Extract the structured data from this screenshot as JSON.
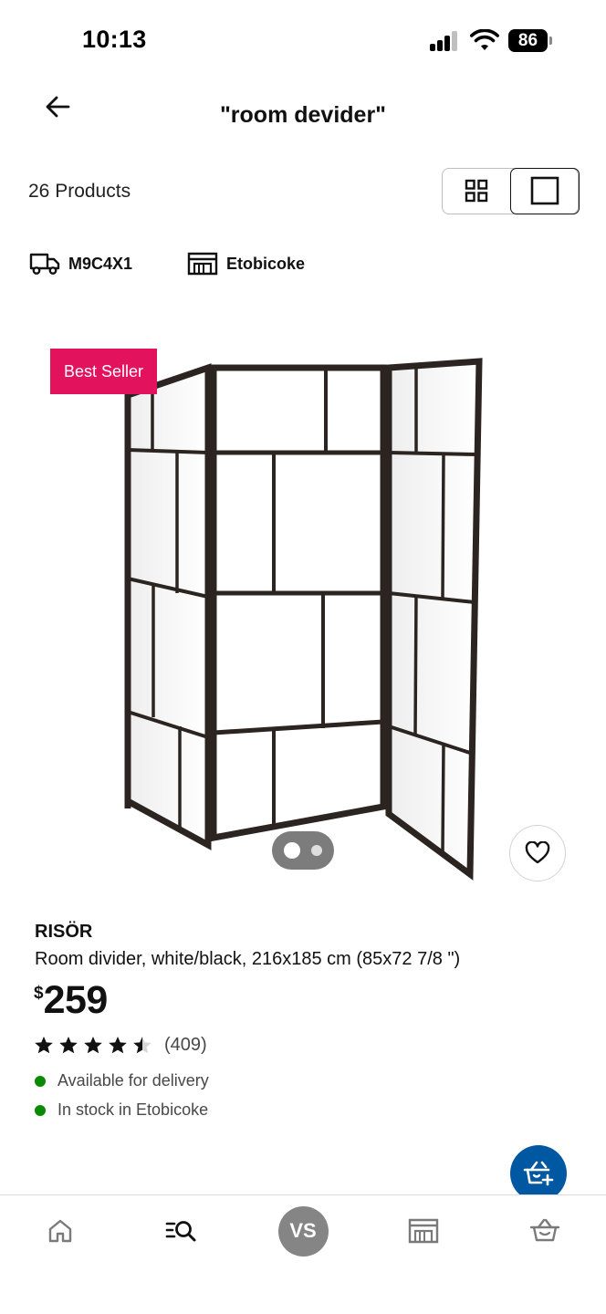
{
  "status_bar": {
    "time": "10:13",
    "battery": "86"
  },
  "header": {
    "title": "\"room devider\""
  },
  "toolbar": {
    "product_count": "26 Products",
    "view_mode": "single"
  },
  "location": {
    "postal_code": "M9C4X1",
    "store": "Etobicoke"
  },
  "product": {
    "badge": "Best Seller",
    "name": "RISÖR",
    "description": "Room divider, white/black, 216x185 cm (85x72 7/8 \")",
    "currency": "$",
    "price": "259",
    "rating": 4.5,
    "rating_max": 5,
    "review_count": "(409)",
    "availability": [
      "Available for delivery",
      "In stock in Etobicoke"
    ],
    "image_count": 2,
    "active_image": 1
  },
  "bottom_nav": {
    "avatar_initials": "VS"
  },
  "colors": {
    "badge": "#e3125c",
    "brand_blue": "#0058a3",
    "in_stock": "#0a8a00",
    "avatar_bg": "#858585"
  }
}
